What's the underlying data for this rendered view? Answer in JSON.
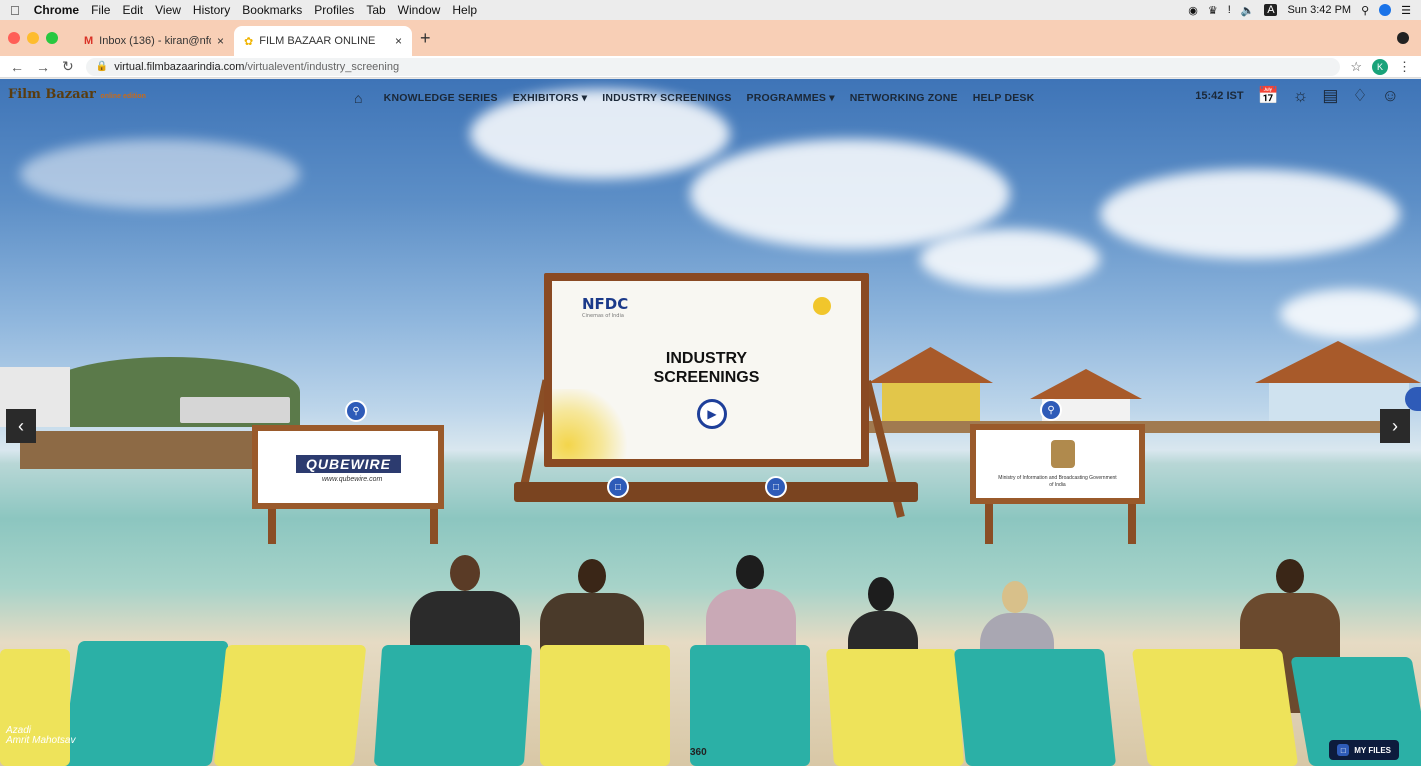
{
  "menubar": {
    "app": "Chrome",
    "items": [
      "File",
      "Edit",
      "View",
      "History",
      "Bookmarks",
      "Profiles",
      "Tab",
      "Window",
      "Help"
    ],
    "clock": "Sun 3:42 PM"
  },
  "tabs": [
    {
      "label": "Inbox (136) - kiran@nfdcindia...",
      "icon": "gmail-icon"
    },
    {
      "label": "FILM BAZAAR ONLINE",
      "icon": "filmbazaar-icon"
    }
  ],
  "address": {
    "domain": "virtual.filmbazaarindia.com",
    "path": "/virtualevent/industry_screening",
    "avatar": "K"
  },
  "site": {
    "logo": "Film Bazaar",
    "logo_sub": "online edition",
    "nav": [
      "KNOWLEDGE SERIES",
      "EXHIBITORS",
      "INDUSTRY SCREENINGS",
      "PROGRAMMES",
      "NETWORKING ZONE",
      "HELP DESK"
    ],
    "time": "15:42 IST"
  },
  "scene": {
    "screen_brand": "NFDC",
    "screen_brand_sub": "Cinemas of India",
    "screen_title_1": "INDUSTRY",
    "screen_title_2": "SCREENINGS",
    "qube_logo": "QUBEWIRE",
    "qube_url": "www.qubewire.com",
    "ministry_caption": "Ministry of Information and Broadcasting Government of India",
    "azadi_1": "Azadi",
    "azadi_2": "Amrit Mahotsav",
    "view_360": "360",
    "my_files": "MY FILES"
  }
}
